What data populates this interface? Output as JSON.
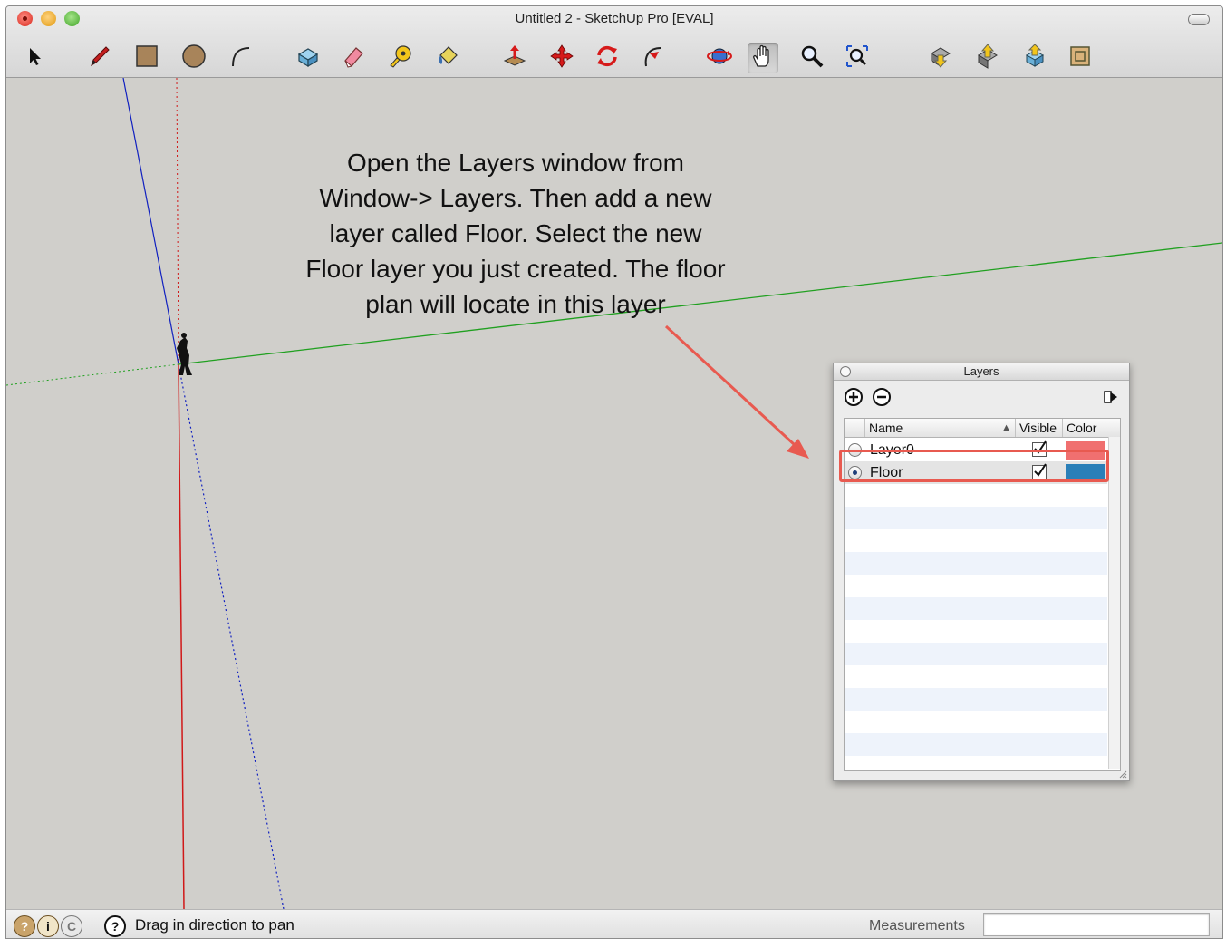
{
  "window": {
    "title": "Untitled 2 - SketchUp Pro [EVAL]"
  },
  "toolbar": {
    "tools": [
      {
        "id": "select",
        "icon": "arrow-cursor-icon"
      },
      {
        "id": "line",
        "icon": "pencil-icon"
      },
      {
        "id": "rectangle",
        "icon": "rectangle-icon"
      },
      {
        "id": "circle",
        "icon": "circle-icon"
      },
      {
        "id": "arc",
        "icon": "arc-icon"
      },
      {
        "id": "make-component",
        "icon": "component-icon"
      },
      {
        "id": "eraser",
        "icon": "eraser-icon"
      },
      {
        "id": "tape-measure",
        "icon": "tape-measure-icon"
      },
      {
        "id": "paint-bucket",
        "icon": "paint-bucket-icon"
      },
      {
        "id": "push-pull",
        "icon": "push-pull-icon"
      },
      {
        "id": "move",
        "icon": "move-icon"
      },
      {
        "id": "rotate",
        "icon": "rotate-icon"
      },
      {
        "id": "follow-me",
        "icon": "follow-me-icon"
      },
      {
        "id": "orbit",
        "icon": "orbit-icon"
      },
      {
        "id": "pan",
        "icon": "hand-icon",
        "active": true
      },
      {
        "id": "zoom",
        "icon": "magnifier-icon"
      },
      {
        "id": "zoom-extents",
        "icon": "zoom-extents-icon"
      },
      {
        "id": "get-models",
        "icon": "get-models-icon"
      },
      {
        "id": "share-model",
        "icon": "share-model-icon"
      },
      {
        "id": "share-component",
        "icon": "share-component-icon"
      },
      {
        "id": "extension-warehouse",
        "icon": "extension-warehouse-icon"
      }
    ]
  },
  "annotation": {
    "lines": [
      "Open the Layers window from",
      "Window-> Layers. Then add a new",
      "layer called Floor. Select the new",
      "Floor layer you just created. The floor",
      "plan will locate in this layer"
    ],
    "arrow_color": "#e85a50"
  },
  "layers_panel": {
    "title": "Layers",
    "columns": {
      "name": "Name",
      "visible": "Visible",
      "color": "Color"
    },
    "sort_indicator": "▲",
    "rows": [
      {
        "name": "Layer0",
        "visible": true,
        "active": false,
        "color": "#f07070"
      },
      {
        "name": "Floor",
        "visible": true,
        "active": true,
        "color": "#2a7fb8"
      }
    ]
  },
  "statusbar": {
    "message": "Drag in direction to pan",
    "measurements_label": "Measurements",
    "measurements_value": ""
  },
  "colors": {
    "viewport_bg": "#d0cfcb",
    "axis_red": "#d01818",
    "axis_green": "#20a020",
    "axis_blue": "#1020c0",
    "highlight": "#e85a50"
  }
}
